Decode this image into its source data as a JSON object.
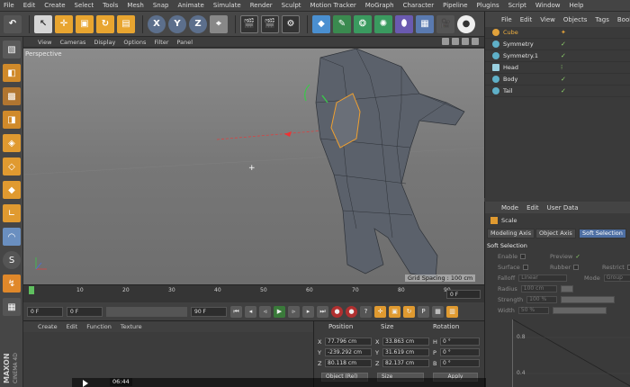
{
  "menu": [
    "File",
    "Edit",
    "Create",
    "Select",
    "Tools",
    "Mesh",
    "Snap",
    "Animate",
    "Simulate",
    "Render",
    "Sculpt",
    "Motion Tracker",
    "MoGraph",
    "Character",
    "Pipeline",
    "Plugins",
    "Script",
    "Window",
    "Help"
  ],
  "toolbar": {
    "axis_x": "X",
    "axis_y": "Y",
    "axis_z": "Z"
  },
  "viewport": {
    "menu": [
      "View",
      "Cameras",
      "Display",
      "Options",
      "Filter",
      "Panel"
    ],
    "label": "Perspective",
    "grid_spacing": "Grid Spacing : 100 cm"
  },
  "timeline": {
    "ticks": [
      "0",
      "10",
      "20",
      "30",
      "40",
      "50",
      "60",
      "70",
      "80",
      "90"
    ],
    "current_frame": "0 F"
  },
  "playback": {
    "start": "0 F",
    "min": "0 F",
    "max": "90 F"
  },
  "materials": {
    "menu": [
      "Create",
      "Edit",
      "Function",
      "Texture"
    ]
  },
  "coordinates": {
    "header_position": "Position",
    "header_size": "Size",
    "header_rotation": "Rotation",
    "rows": [
      {
        "axis": "X",
        "pos": "77.796 cm",
        "size": "33.863 cm",
        "rot_label": "H",
        "rot": "0 °"
      },
      {
        "axis": "Y",
        "pos": "-239.292 cm",
        "size": "31.619 cm",
        "rot_label": "P",
        "rot": "0 °"
      },
      {
        "axis": "Z",
        "pos": "80.118 cm",
        "size": "82.137 cm",
        "rot_label": "B",
        "rot": "0 °"
      }
    ],
    "mode_select": "Object (Rel)",
    "size_select": "Size",
    "apply": "Apply"
  },
  "objects": {
    "menu": [
      "File",
      "Edit",
      "View",
      "Objects",
      "Tags",
      "Bookm"
    ],
    "items": [
      {
        "name": "Cube",
        "color": "#e2a23b"
      },
      {
        "name": "Symmetry",
        "color": "#5fb0c8"
      },
      {
        "name": "Symmetry.1",
        "color": "#5fb0c8"
      },
      {
        "name": "Head",
        "color": "#9ad0e0"
      },
      {
        "name": "Body",
        "color": "#5fb0c8"
      },
      {
        "name": "Tail",
        "color": "#5fb0c8"
      }
    ]
  },
  "attributes": {
    "menu": [
      "Mode",
      "Edit",
      "User Data"
    ],
    "title": "Scale",
    "tabs": [
      "Modeling Axis",
      "Object Axis",
      "Soft Selection"
    ],
    "section": "Soft Selection",
    "enable": "Enable",
    "preview": "Preview",
    "surface": "Surface",
    "rubber": "Rubber",
    "restrict": "Restrict",
    "falloff": "Falloff",
    "falloff_value": "Linear",
    "mode": "Mode",
    "mode_value": "Group",
    "radius": "Radius",
    "radius_value": "100 cm",
    "strength": "Strength",
    "strength_value": "100 %",
    "width": "Width",
    "width_value": "50 %",
    "graph_08": "0.8",
    "graph_04": "0.4"
  },
  "video": {
    "time": "06:44"
  },
  "brand": {
    "line1": "MAXON",
    "line2": "CINEMA 4D"
  }
}
